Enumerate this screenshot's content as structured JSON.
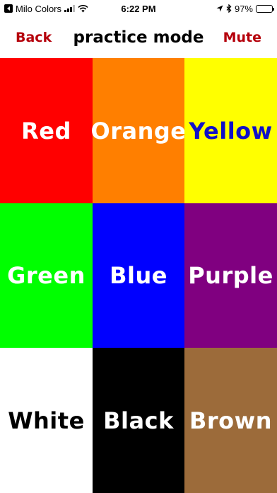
{
  "status_bar": {
    "app_back_label": "Milo Colors",
    "time": "6:22 PM",
    "battery_percent": "97%",
    "battery_level": 0.97
  },
  "nav": {
    "back_label": "Back",
    "title": "practice mode",
    "mute_label": "Mute",
    "button_color": "#b5000b"
  },
  "tiles": [
    {
      "label": "Red",
      "bg": "#ff0000",
      "fg": "#ffffff"
    },
    {
      "label": "Orange",
      "bg": "#ff7f00",
      "fg": "#ffffff"
    },
    {
      "label": "Yellow",
      "bg": "#ffff00",
      "fg": "#1010c8"
    },
    {
      "label": "Green",
      "bg": "#00ff00",
      "fg": "#ffffff"
    },
    {
      "label": "Blue",
      "bg": "#0000ff",
      "fg": "#ffffff"
    },
    {
      "label": "Purple",
      "bg": "#800080",
      "fg": "#ffffff"
    },
    {
      "label": "White",
      "bg": "#ffffff",
      "fg": "#000000"
    },
    {
      "label": "Black",
      "bg": "#000000",
      "fg": "#ffffff"
    },
    {
      "label": "Brown",
      "bg": "#9c6b3a",
      "fg": "#ffffff"
    }
  ]
}
